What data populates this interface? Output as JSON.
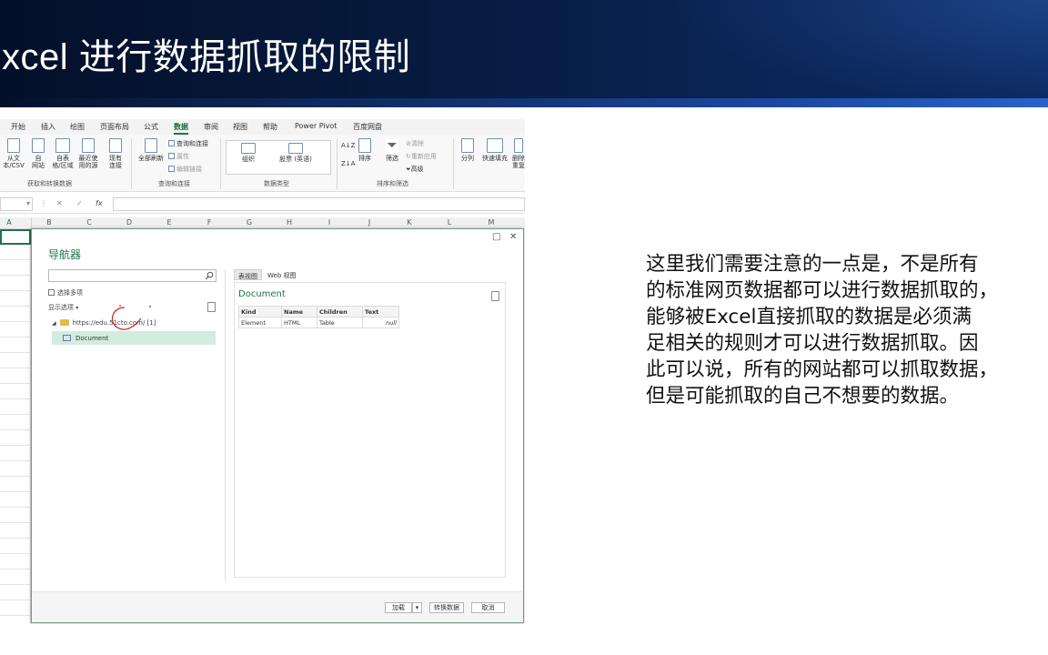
{
  "slide": {
    "title": "xcel 进行数据抓取的限制",
    "note_lines": [
      "这里我们需要注意的一点是，不是所有",
      "的标准网页数据都可以进行数据抓取的，",
      "能够被Excel直接抓取的数据是必须满",
      "足相关的规则才可以进行数据抓取。因",
      "此可以说，所有的网站都可以抓取数据，",
      "但是可能抓取的自己不想要的数据。"
    ]
  },
  "excel": {
    "ribbon_tabs": [
      "开始",
      "插入",
      "绘图",
      "页面布局",
      "公式",
      "数据",
      "审阅",
      "视图",
      "帮助",
      "Power Pivot",
      "百度网盘"
    ],
    "active_tab": "数据",
    "get_group": {
      "buttons": [
        {
          "line1": "从文",
          "line2": "本/CSV"
        },
        {
          "line1": "自",
          "line2": "网站"
        },
        {
          "line1": "自表",
          "line2": "格/区域"
        },
        {
          "line1": "最近使",
          "line2": "用的源"
        },
        {
          "line1": "现有",
          "line2": "连接"
        }
      ],
      "caption": "获取和转换数据"
    },
    "query_group": {
      "refresh_all": "全部刷新",
      "items": [
        "查询和连接",
        "属性",
        "编辑链接"
      ],
      "caption": "查询和连接"
    },
    "datatype_group": {
      "items": [
        "组织",
        "股票 (英语)"
      ],
      "caption": "数据类型"
    },
    "sort_group": {
      "sort": "排序",
      "filter": "筛选",
      "clear": "清除",
      "reapply": "重新应用",
      "advanced": "高级",
      "caption": "排序和筛选"
    },
    "tools_group": {
      "split": "分列",
      "flash_fill": "快速填充",
      "remove_dup": "删除",
      "remove_dup2": "重复"
    },
    "fx": "fx",
    "columns": [
      "A",
      "B",
      "C",
      "D",
      "E",
      "F",
      "G",
      "H",
      "I",
      "J",
      "K",
      "L",
      "M"
    ]
  },
  "navigator": {
    "title": "导航器",
    "select_multiple": "选择多项",
    "display_options": "显示选项",
    "tree_url": "https://edu.51cto.com/ [1]",
    "tree_doc": "Document",
    "tabs": [
      "表视图",
      "Web 视图"
    ],
    "preview_title": "Document",
    "table": {
      "headers": [
        "Kind",
        "Name",
        "Children",
        "Text"
      ],
      "rows": [
        [
          "Element",
          "HTML",
          "Table",
          "null"
        ]
      ]
    },
    "footer": {
      "load": "加载",
      "transform": "转换数据",
      "cancel": "取消"
    }
  },
  "colors": {
    "header_dark": "#04102a",
    "header_blue": "#2a62c8",
    "excel_green": "#217346",
    "annotation_red": "#d11f1f"
  }
}
